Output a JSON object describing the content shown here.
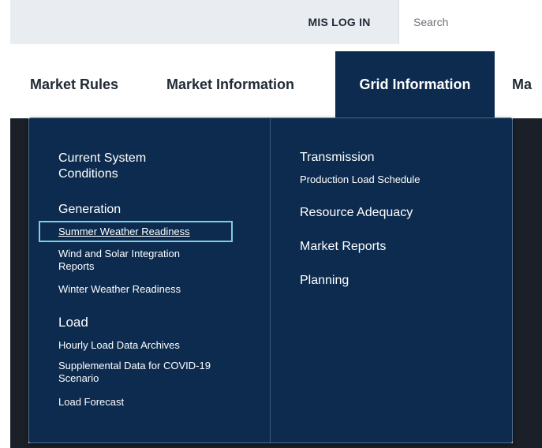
{
  "topbar": {
    "login_label": "MIS LOG IN",
    "search_placeholder": "Search"
  },
  "nav": {
    "items": [
      {
        "label": "Market Rules"
      },
      {
        "label": "Market Information"
      },
      {
        "label": "Grid Information",
        "active": true
      },
      {
        "label": "Ma"
      }
    ]
  },
  "dropdown": {
    "left": {
      "current_system": "Current System Conditions",
      "generation": {
        "title": "Generation",
        "links": [
          "Summer Weather Readiness",
          "Wind and Solar Integration Reports",
          "Winter Weather Readiness"
        ]
      },
      "load": {
        "title": "Load",
        "links": [
          "Hourly Load Data Archives",
          "Supplemental Data for COVID-19 Scenario",
          "Load Forecast"
        ]
      }
    },
    "right": {
      "transmission": {
        "title": "Transmission",
        "links": [
          "Production Load Schedule"
        ]
      },
      "resource_adequacy": "Resource Adequacy",
      "market_reports": "Market Reports",
      "planning": "Planning"
    }
  },
  "colors": {
    "navy": "#0c2b4e",
    "highlight": "#7dcce8",
    "topbar_bg": "#e9ecf1"
  }
}
